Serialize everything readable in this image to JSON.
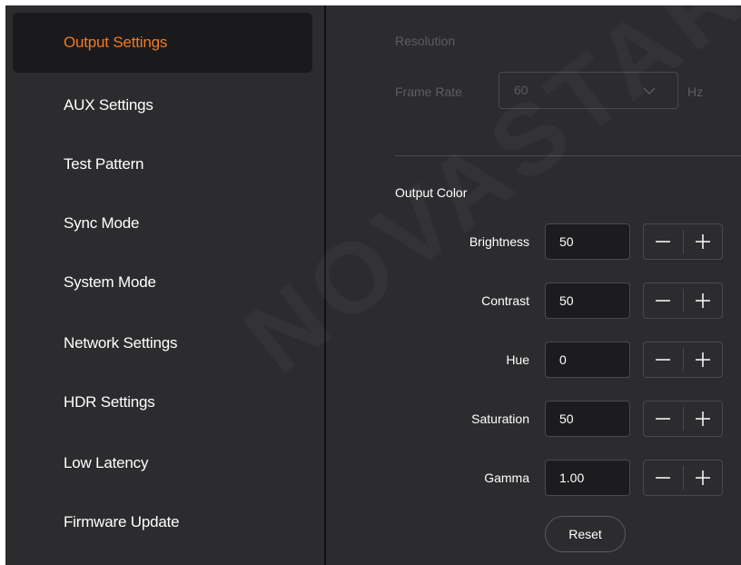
{
  "sidebar": {
    "items": [
      {
        "label": "Output Settings",
        "active": true
      },
      {
        "label": "AUX Settings"
      },
      {
        "label": "Test Pattern"
      },
      {
        "label": "Sync Mode"
      },
      {
        "label": "System Mode"
      },
      {
        "label": "Network Settings"
      },
      {
        "label": "HDR Settings"
      },
      {
        "label": "Low Latency"
      },
      {
        "label": "Firmware Update"
      }
    ]
  },
  "output": {
    "resolution_label": "Resolution",
    "frame_rate": {
      "label": "Frame Rate",
      "value": "60",
      "unit": "Hz",
      "enabled": false
    }
  },
  "output_color": {
    "title": "Output Color",
    "rows": [
      {
        "label": "Brightness",
        "value": "50"
      },
      {
        "label": "Contrast",
        "value": "50"
      },
      {
        "label": "Hue",
        "value": "0"
      },
      {
        "label": "Saturation",
        "value": "50"
      },
      {
        "label": "Gamma",
        "value": "1.00"
      }
    ],
    "reset_label": "Reset"
  },
  "watermark": "NOVASTAR TECH",
  "colors": {
    "accent": "#f47920",
    "background": "#2c2c2e",
    "active_item_bg": "#1a1a1c",
    "input_bg": "#1c1c1e",
    "border": "#4a4a4e",
    "disabled_text": "#5d5d62"
  },
  "icons": {
    "dropdown": "chevron-down-icon",
    "decrement": "minus-icon",
    "increment": "plus-icon"
  }
}
